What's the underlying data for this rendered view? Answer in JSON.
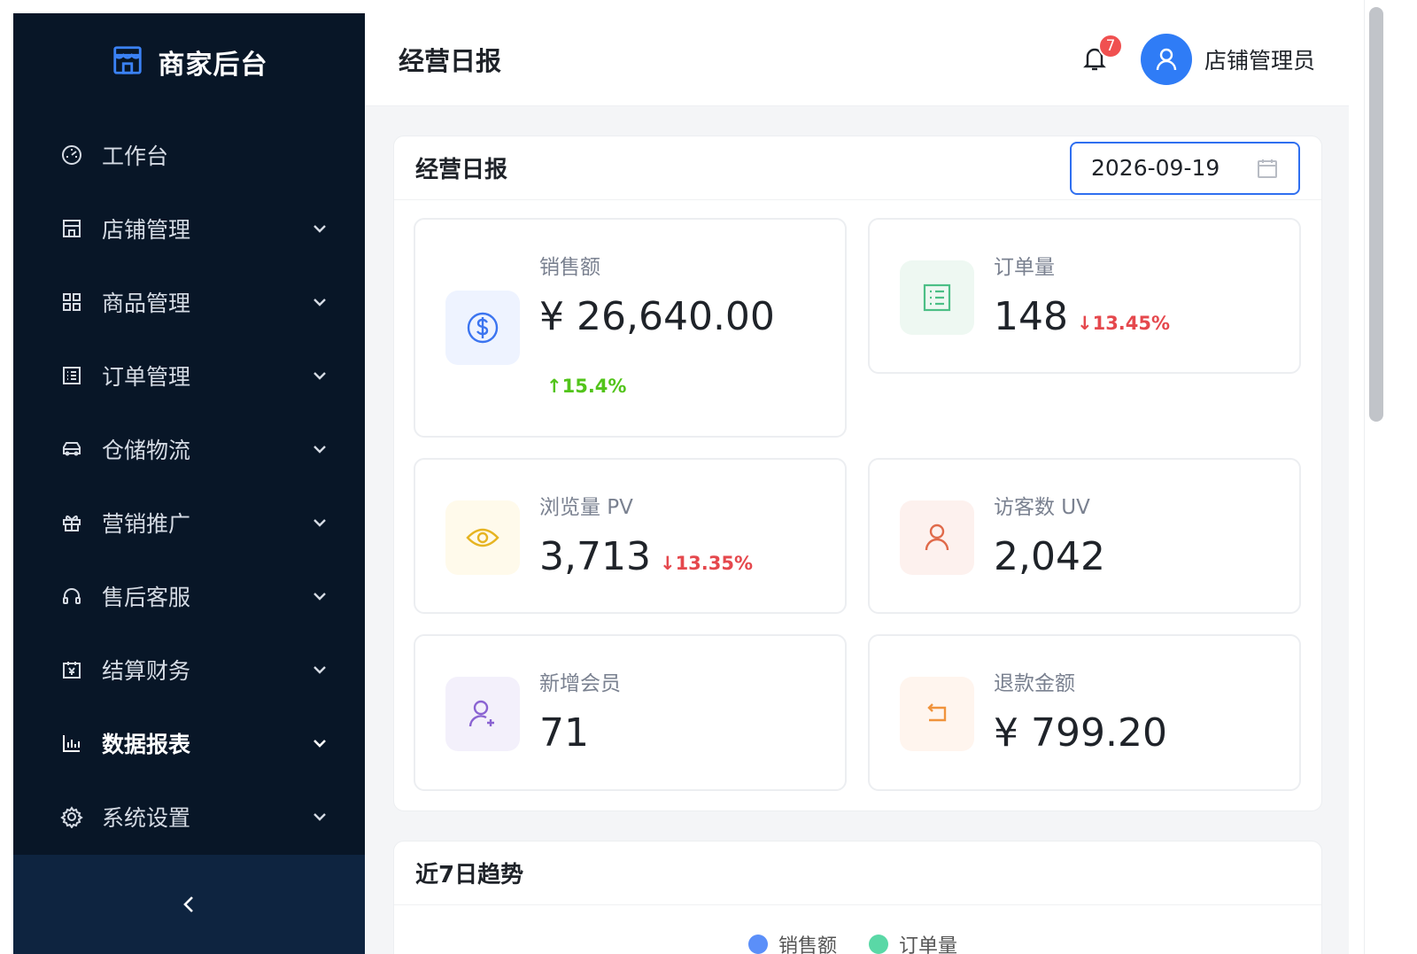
{
  "brand": {
    "title": "商家后台",
    "icon": "store-icon"
  },
  "sidebar": {
    "items": [
      {
        "label": "工作台",
        "icon": "dashboard-icon",
        "has_arrow": false
      },
      {
        "label": "店铺管理",
        "icon": "store-icon",
        "has_arrow": true
      },
      {
        "label": "商品管理",
        "icon": "grid-icon",
        "has_arrow": true
      },
      {
        "label": "订单管理",
        "icon": "list-icon",
        "has_arrow": true
      },
      {
        "label": "仓储物流",
        "icon": "truck-icon",
        "has_arrow": true
      },
      {
        "label": "营销推广",
        "icon": "gift-icon",
        "has_arrow": true
      },
      {
        "label": "售后客服",
        "icon": "headset-icon",
        "has_arrow": true
      },
      {
        "label": "结算财务",
        "icon": "finance-icon",
        "has_arrow": true
      },
      {
        "label": "数据报表",
        "icon": "bar-chart-icon",
        "has_arrow": true,
        "active": true
      },
      {
        "label": "系统设置",
        "icon": "gear-icon",
        "has_arrow": true
      }
    ],
    "collapse_icon": "chevron-left-icon"
  },
  "header": {
    "title": "经营日报",
    "notification_count": "7",
    "user_name": "店铺管理员"
  },
  "daily": {
    "title": "经营日报",
    "date": "2026-09-19",
    "stats": {
      "sales": {
        "label": "销售额",
        "value": "¥ 26,640.00",
        "change": "↑15.4%"
      },
      "orders": {
        "label": "订单量",
        "value": "148",
        "change": "↓13.45%"
      },
      "pv": {
        "label": "浏览量 PV",
        "value": "3,713",
        "change": "↓13.35%"
      },
      "uv": {
        "label": "访客数 UV",
        "value": "2,042"
      },
      "members": {
        "label": "新增会员",
        "value": "71"
      },
      "refund": {
        "label": "退款金额",
        "value": "¥ 799.20"
      }
    }
  },
  "trend": {
    "title": "近7日趋势",
    "legend": [
      {
        "name": "销售额",
        "color": "#5b8ff9"
      },
      {
        "name": "订单量",
        "color": "#5ad8a6"
      }
    ]
  },
  "colors": {
    "accent": "#2f7cf6",
    "sidebar_bg": "#081627",
    "up": "#52c41a",
    "down": "#e5484d"
  }
}
